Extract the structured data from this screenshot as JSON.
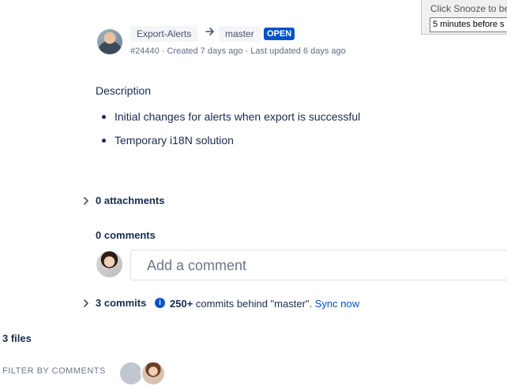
{
  "snooze": {
    "hint": "Click Snooze to be",
    "selected": "5 minutes before s"
  },
  "pr": {
    "source_branch": "Export-Alerts",
    "target_branch": "master",
    "status": "OPEN",
    "meta": "#24440 · Created 7 days ago · Last updated 6 days ago"
  },
  "description": {
    "heading": "Description",
    "items": [
      "Initial changes for alerts when export is successful",
      "Temporary i18N solution"
    ]
  },
  "attachments": {
    "label": "0 attachments"
  },
  "comments": {
    "label": "0 comments",
    "placeholder": "Add a comment"
  },
  "commits": {
    "label": "3 commits",
    "behind_count": "250+",
    "behind_text": " commits behind \"master\". ",
    "sync_link": "Sync now"
  },
  "files": {
    "label": "3 files"
  },
  "filter": {
    "label": "FILTER BY COMMENTS"
  },
  "colors": {
    "accent": "#0052cc",
    "text": "#172b4d",
    "muted": "#5e6c84"
  }
}
